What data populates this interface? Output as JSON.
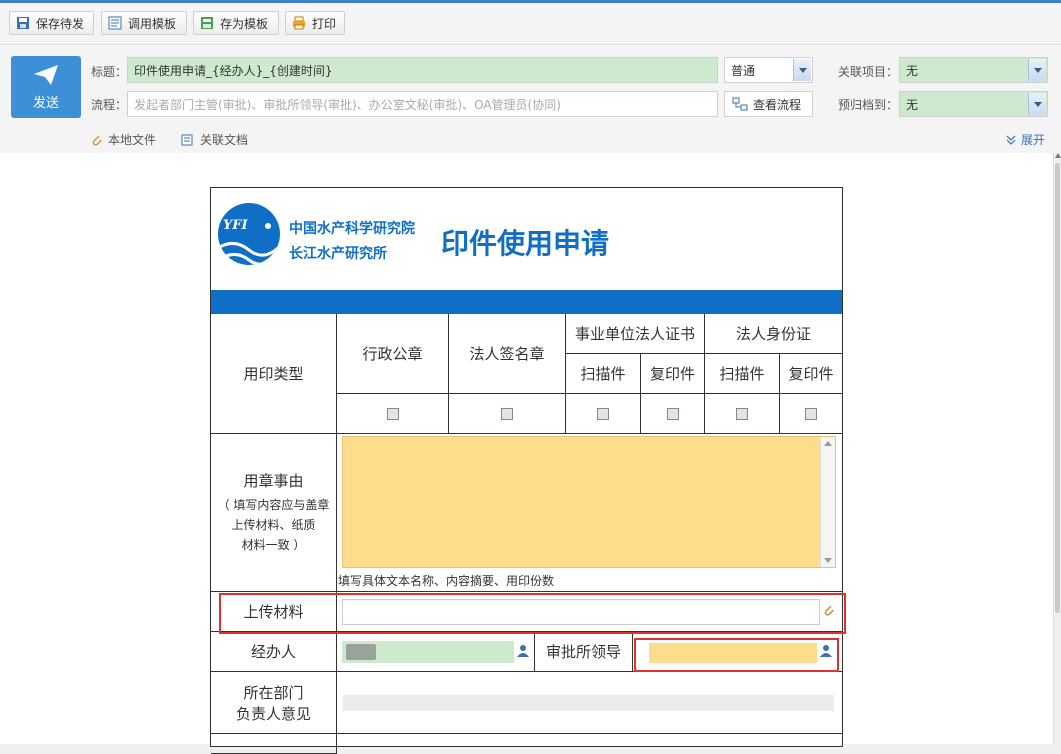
{
  "toolbar": {
    "save_draft": "保存待发",
    "load_template": "调用模板",
    "save_template": "存为模板",
    "print": "打印"
  },
  "header": {
    "send_label": "发送",
    "title_label": "标题：",
    "title_value": "印件使用申请_{经办人}_{创建时间}",
    "priority_value": "普通",
    "related_project_label": "关联项目：",
    "related_project_value": "无",
    "flow_label": "流程：",
    "flow_placeholder": "发起者部门主管(审批)、审批所领导(审批)、办公室文秘(审批)、OA管理员(协同)",
    "view_flow": "查看流程",
    "archive_label": "预归档到：",
    "archive_value": "无",
    "local_file": "本地文件",
    "related_doc": "关联文档",
    "expand": "展开"
  },
  "form": {
    "org_name_line1": "中国水产科学研究院",
    "org_name_line2": "长江水产研究所",
    "logo_text": "YFI",
    "title": "印件使用申请",
    "seal_type_label": "用印类型",
    "admin_seal": "行政公章",
    "legal_sign_seal": "法人签名章",
    "institution_cert": "事业单位法人证书",
    "legal_id": "法人身份证",
    "scan": "扫描件",
    "copy": "复印件",
    "reason_label": "用章事由",
    "reason_note_1": "（ 填写内容应与盖章",
    "reason_note_2": "上传材料、纸质",
    "reason_note_3": "材料一致 ）",
    "reason_hint": "填写具体文本名称、内容摘要、用印份数",
    "upload_label": "上传材料",
    "handler_label": "经办人",
    "leader_label": "审批所领导",
    "dept_label_1": "所在部门",
    "dept_label_2": "负责人意见"
  },
  "colors": {
    "accent": "#3d8fd6",
    "field_green": "#cfe9cf",
    "field_yellow": "#fddc8c",
    "banner_blue": "#0f6fc6",
    "highlight_red": "#e0312b"
  }
}
